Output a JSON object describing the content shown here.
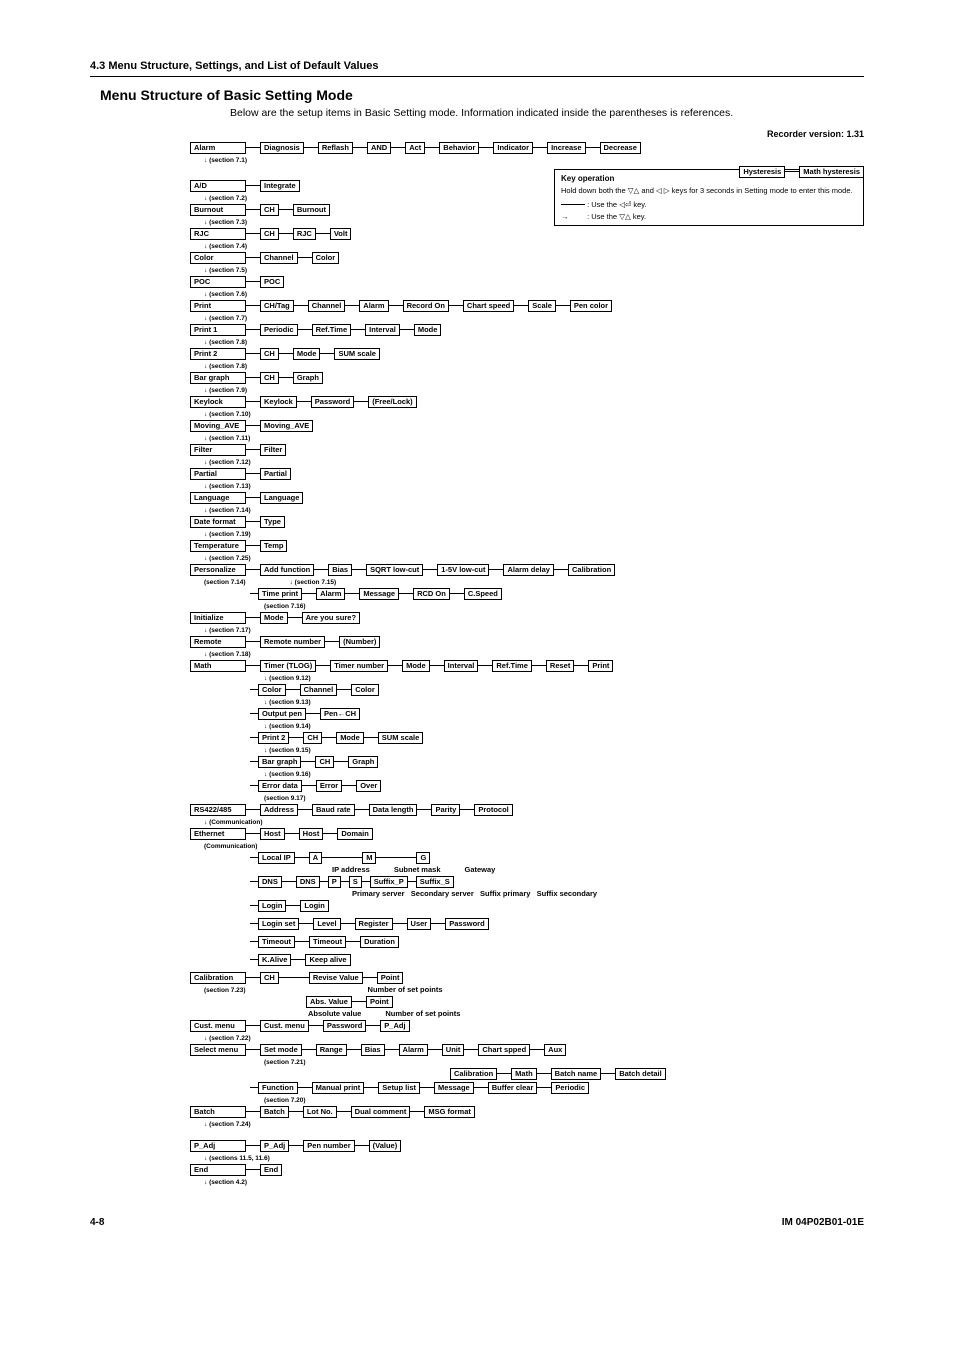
{
  "page_header": "4.3  Menu Structure, Settings, and List of Default Values",
  "title": "Menu Structure of Basic Setting Mode",
  "intro": "Below are the setup items in Basic Setting mode. Information indicated inside the parentheses is references.",
  "version": "Recorder version: 1.31",
  "footer_left": "4-8",
  "footer_right": "IM 04P02B01-01E",
  "keyop": {
    "title": "Key operation",
    "line1a": "Hold down both the ",
    "line1b": " and ",
    "line1c": " keys for 3 seconds in Setting mode to enter this mode.",
    "arrow_left_label": ":  Use the ",
    "arrow_left_key": " key.",
    "arrow_right_label": ":  Use the ",
    "arrow_right_key": " key."
  },
  "menu": {
    "alarm": {
      "label": "Alarm",
      "ref": "(section 7.1)",
      "chain": [
        "Diagnosis",
        "Reflash",
        "AND",
        "Act",
        "Behavior",
        "Indicator",
        "Increase",
        "Decrease"
      ],
      "sub": [
        "Hysteresis",
        "Math hysteresis"
      ]
    },
    "ad": {
      "label": "A/D",
      "ref": "(section 7.2)",
      "chain": [
        "Integrate"
      ]
    },
    "burnout": {
      "label": "Burnout",
      "ref": "(section 7.3)",
      "chain": [
        "CH",
        "Burnout"
      ]
    },
    "rjc": {
      "label": "RJC",
      "ref": "(section 7.4)",
      "chain": [
        "CH",
        "RJC",
        "Volt"
      ]
    },
    "color": {
      "label": "Color",
      "ref": "(section 7.5)",
      "chain": [
        "Channel",
        "Color"
      ]
    },
    "poc": {
      "label": "POC",
      "ref": "(section 7.6)",
      "chain": [
        "POC"
      ]
    },
    "print": {
      "label": "Print",
      "ref": "(section 7.7)",
      "chain": [
        "CH/Tag",
        "Channel",
        "Alarm",
        "Record On",
        "Chart speed",
        "Scale",
        "Pen color"
      ]
    },
    "print1": {
      "label": "Print 1",
      "ref": "(section 7.8)",
      "chain": [
        "Periodic",
        "Ref.Time",
        "Interval",
        "Mode"
      ]
    },
    "print2": {
      "label": "Print 2",
      "ref": "(section 7.8)",
      "chain": [
        "CH",
        "Mode",
        "SUM scale"
      ]
    },
    "bargraph": {
      "label": "Bar graph",
      "ref": "(section 7.9)",
      "chain": [
        "CH",
        "Graph"
      ]
    },
    "keylock": {
      "label": "Keylock",
      "ref": "(section 7.10)",
      "chain": [
        "Keylock",
        "Password",
        "(Free/Lock)"
      ]
    },
    "movingave": {
      "label": "Moving_AVE",
      "ref": "(section 7.11)",
      "chain": [
        "Moving_AVE"
      ]
    },
    "filter": {
      "label": "Filter",
      "ref": "(section 7.12)",
      "chain": [
        "Filter"
      ]
    },
    "partial": {
      "label": "Partial",
      "ref": "(section 7.13)",
      "chain": [
        "Partial"
      ]
    },
    "language": {
      "label": "Language",
      "ref": "(section 7.14)",
      "chain": [
        "Language"
      ]
    },
    "dateformat": {
      "label": "Date format",
      "ref": "(section 7.19)",
      "chain": [
        "Type"
      ]
    },
    "temperature": {
      "label": "Temperature",
      "ref": "(section 7.25)",
      "chain": [
        "Temp"
      ]
    },
    "personalize": {
      "label": "Personalize",
      "ref": "(section 7.14)",
      "sub1": {
        "label": "Add function",
        "ref": "(section 7.15)",
        "chain": [
          "Bias",
          "SQRT low-cut",
          "1-5V low-cut",
          "Alarm delay",
          "Calibration"
        ]
      },
      "sub2": {
        "label": "Time print",
        "ref": "(section 7.16)",
        "chain": [
          "Alarm",
          "Message",
          "RCD On",
          "C.Speed"
        ]
      }
    },
    "initialize": {
      "label": "Initialize",
      "ref": "(section 7.17)",
      "chain": [
        "Mode",
        "Are you sure?"
      ]
    },
    "remote": {
      "label": "Remote",
      "ref": "(section 7.18)",
      "chain": [
        "Remote number",
        "(Number)"
      ]
    },
    "math": {
      "label": "Math",
      "subs": [
        {
          "label": "Timer (TLOG)",
          "ref": "(section 9.12)",
          "chain": [
            "Timer number",
            "Mode",
            "Interval",
            "Ref.Time",
            "Reset",
            "Print"
          ]
        },
        {
          "label": "Color",
          "ref": "(section 9.13)",
          "chain": [
            "Channel",
            "Color"
          ]
        },
        {
          "label": "Output pen",
          "ref": "(section 9.14)",
          "chain": [
            "Pen←CH"
          ]
        },
        {
          "label": "Print 2",
          "ref": "(section 9.15)",
          "chain": [
            "CH",
            "Mode",
            "SUM scale"
          ]
        },
        {
          "label": "Bar graph",
          "ref": "(section 9.16)",
          "chain": [
            "CH",
            "Graph"
          ]
        },
        {
          "label": "Error data",
          "ref": "(section 9.17)",
          "chain": [
            "Error",
            "Over"
          ]
        }
      ]
    },
    "rs422": {
      "label": "RS422/485",
      "ref": "(Communication)",
      "chain": [
        "Address",
        "Baud rate",
        "Data length",
        "Parity",
        "Protocol"
      ]
    },
    "ethernet": {
      "label": "Ethernet",
      "ref": "(Communication)",
      "subs": [
        {
          "label": "Host",
          "chain": [
            "Host",
            "Domain"
          ]
        },
        {
          "label": "Local IP",
          "chain": [
            "A",
            "M",
            "G"
          ],
          "under": [
            "IP address",
            "Subnet mask",
            "Gateway"
          ]
        },
        {
          "label": "DNS",
          "chain": [
            "DNS",
            "P",
            "S",
            "Suffix_P",
            "Suffix_S"
          ],
          "under2": [
            "Primary server",
            "Secondary server",
            "Suffix primary",
            "Suffix secondary"
          ]
        },
        {
          "label": "Login",
          "chain": [
            "Login"
          ]
        },
        {
          "label": "Login set",
          "chain": [
            "Level",
            "Register",
            "User",
            "Password"
          ]
        },
        {
          "label": "Timeout",
          "chain": [
            "Timeout",
            "Duration"
          ]
        },
        {
          "label": "K.Alive",
          "chain": [
            "Keep alive"
          ]
        }
      ]
    },
    "calibration": {
      "label": "Calibration",
      "ref": "(section 7.23)",
      "pre": "CH",
      "subs": [
        {
          "label": "Revise Value",
          "chain": [
            "Point"
          ],
          "under": [
            "Number of set points"
          ]
        },
        {
          "label": "Abs. Value",
          "sublabel": "Absolute value",
          "chain": [
            "Point"
          ],
          "under": [
            "Number of set points"
          ]
        }
      ]
    },
    "custmenu": {
      "label": "Cust. menu",
      "ref": "(section 7.22)",
      "chain": [
        "Cust. menu",
        "Password",
        "P_Adj"
      ]
    },
    "selectmenu": {
      "label": "Select menu",
      "sub1": {
        "label": "Set mode",
        "ref": "(section 7.21)",
        "chain": [
          "Range",
          "Bias",
          "Alarm",
          "Unit",
          "Chart spped",
          "Aux"
        ],
        "sub": [
          "Calibration",
          "Math",
          "Batch name",
          "Batch detail"
        ]
      },
      "sub2": {
        "label": "Function",
        "ref": "(section 7.20)",
        "chain": [
          "Manual print",
          "Setup list",
          "Message",
          "Buffer clear",
          "Periodic"
        ]
      }
    },
    "batch": {
      "label": "Batch",
      "ref": "(section 7.24)",
      "chain": [
        "Batch",
        "Lot No.",
        "Dual comment",
        "MSG format"
      ]
    },
    "padj": {
      "label": "P_Adj",
      "ref": "(sections 11.5, 11.6)",
      "chain": [
        "P_Adj",
        "Pen number",
        "(Value)"
      ]
    },
    "end": {
      "label": "End",
      "ref": "(section 4.2)",
      "chain": [
        "End"
      ]
    }
  }
}
